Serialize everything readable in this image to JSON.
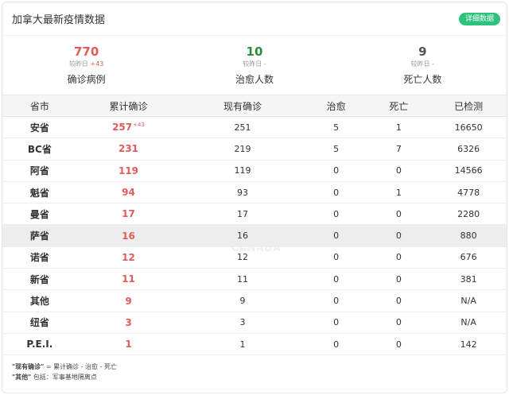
{
  "header": {
    "title": "加拿大最新疫情数据",
    "detail_button": "详细数据"
  },
  "summary": [
    {
      "value": "770",
      "delta_label": "较昨日",
      "delta": "+43",
      "label": "确诊病例",
      "color": "#e25b5b"
    },
    {
      "value": "10",
      "delta_label": "较昨日",
      "delta": "-",
      "label": "治愈人数",
      "color": "#2e8b3e"
    },
    {
      "value": "9",
      "delta_label": "较昨日",
      "delta": "-",
      "label": "死亡人数",
      "color": "#555555"
    }
  ],
  "table": {
    "headers": [
      "省市",
      "累计确诊",
      "现有确诊",
      "治愈",
      "死亡",
      "已检测"
    ],
    "rows": [
      {
        "province": "安省",
        "confirmed": "257",
        "confirmed_delta": "+43",
        "current": "251",
        "recovered": "5",
        "deaths": "1",
        "tested": "16650"
      },
      {
        "province": "BC省",
        "confirmed": "231",
        "confirmed_delta": "",
        "current": "219",
        "recovered": "5",
        "deaths": "7",
        "tested": "6326"
      },
      {
        "province": "阿省",
        "confirmed": "119",
        "confirmed_delta": "",
        "current": "119",
        "recovered": "0",
        "deaths": "0",
        "tested": "14566"
      },
      {
        "province": "魁省",
        "confirmed": "94",
        "confirmed_delta": "",
        "current": "93",
        "recovered": "0",
        "deaths": "1",
        "tested": "4778"
      },
      {
        "province": "曼省",
        "confirmed": "17",
        "confirmed_delta": "",
        "current": "17",
        "recovered": "0",
        "deaths": "0",
        "tested": "2280"
      },
      {
        "province": "萨省",
        "confirmed": "16",
        "confirmed_delta": "",
        "current": "16",
        "recovered": "0",
        "deaths": "0",
        "tested": "880"
      },
      {
        "province": "诺省",
        "confirmed": "12",
        "confirmed_delta": "",
        "current": "12",
        "recovered": "0",
        "deaths": "0",
        "tested": "676"
      },
      {
        "province": "新省",
        "confirmed": "11",
        "confirmed_delta": "",
        "current": "11",
        "recovered": "0",
        "deaths": "0",
        "tested": "381"
      },
      {
        "province": "其他",
        "confirmed": "9",
        "confirmed_delta": "",
        "current": "9",
        "recovered": "0",
        "deaths": "0",
        "tested": "N/A"
      },
      {
        "province": "纽省",
        "confirmed": "3",
        "confirmed_delta": "",
        "current": "3",
        "recovered": "0",
        "deaths": "0",
        "tested": "N/A"
      },
      {
        "province": "P.E.I.",
        "confirmed": "1",
        "confirmed_delta": "",
        "current": "1",
        "recovered": "0",
        "deaths": "0",
        "tested": "142"
      }
    ],
    "highlight_row": 5
  },
  "watermark": {
    "big": "51",
    "cn": "加国无忧",
    "en": "CANADA"
  },
  "notes": [
    {
      "term": "\"现有确诊\"",
      "text": " = 累计确诊 - 治愈 - 死亡"
    },
    {
      "term": "\"其他\"",
      "text": " 包括：军事基地隔离点"
    }
  ]
}
